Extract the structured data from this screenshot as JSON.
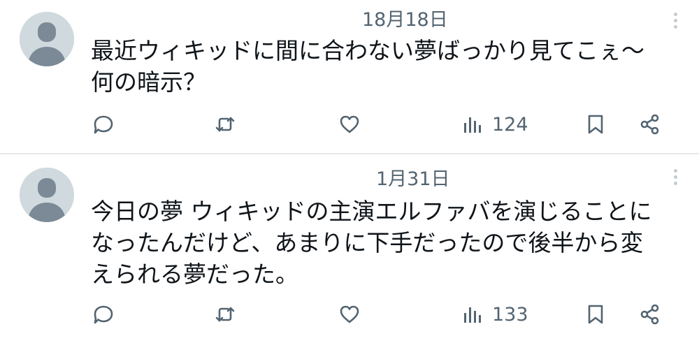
{
  "posts": [
    {
      "date": "18月18日",
      "lines": [
        "最近ウィキッドに間に合わない夢ばっかり見てこぇ～",
        "何の暗示？"
      ],
      "views": "124"
    },
    {
      "date": "1月31日",
      "lines": [
        "今日の夢 ウィキッドの主演エルファバを演じることに",
        "なったんだけど、あまりに下手だったので後半から変",
        "えられる夢だった。"
      ],
      "views": "133"
    }
  ],
  "icons": {
    "avatar": "default-avatar-icon",
    "reply": "reply-icon",
    "repost": "repost-icon",
    "like": "heart-icon",
    "views": "views-chart-icon",
    "bookmark": "bookmark-icon",
    "share": "share-icon",
    "more": "more-vertical-icon"
  },
  "colors": {
    "text": "#0f1419",
    "secondary": "#536471",
    "avatar_bg": "#cfd9de",
    "avatar_fg": "#7b8a96",
    "divider": "#e6e9ec"
  }
}
